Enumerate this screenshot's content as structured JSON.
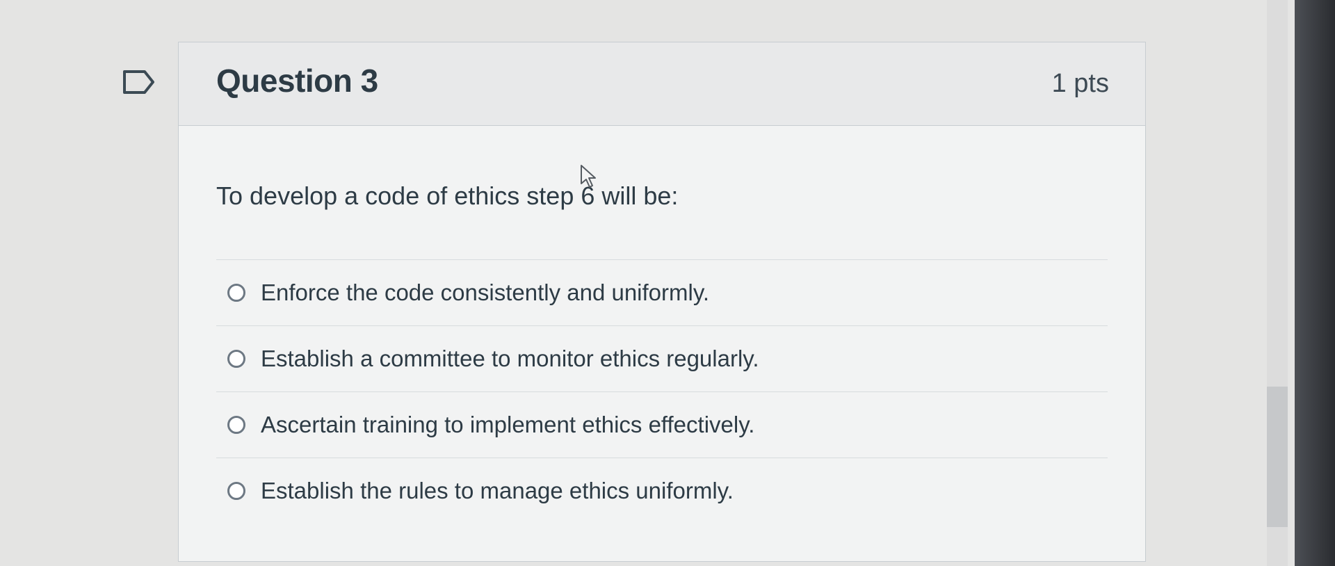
{
  "question": {
    "title": "Question 3",
    "points": "1 pts",
    "text": "To develop a code of ethics step 6 will be:",
    "answers": [
      "Enforce the code consistently and uniformly.",
      "Establish a committee to monitor ethics regularly.",
      "Ascertain training to implement ethics effectively.",
      "Establish the rules to manage ethics uniformly."
    ]
  },
  "icons": {
    "flag": "flag-question-icon",
    "cursor": "mouse-cursor-icon",
    "radio": "radio-button-icon"
  },
  "colors": {
    "text": "#2d3b45",
    "border": "#c7cdd1",
    "header_bg": "#e8e9ea",
    "flag": "#3b4a54"
  }
}
